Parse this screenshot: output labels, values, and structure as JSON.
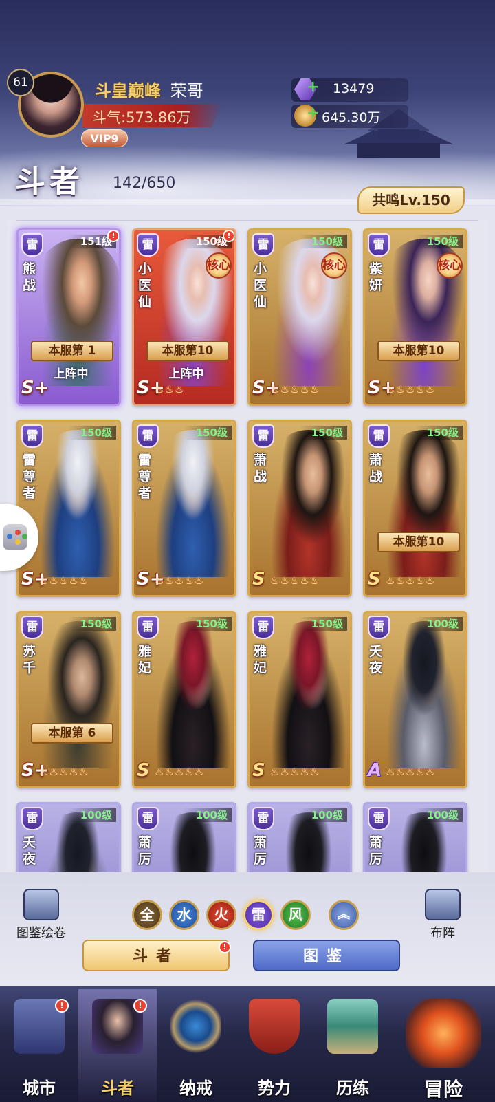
{
  "player": {
    "level": "61",
    "title": "斗皇巅峰",
    "name": "荣哥",
    "power_label": "斗气:573.86万",
    "vip": "VIP9"
  },
  "resources": {
    "crystal": "13479",
    "gold": "645.30万"
  },
  "section": {
    "title": "斗者",
    "count": "142/650",
    "resonance": "共鸣Lv.150"
  },
  "heroes": [
    {
      "name": "熊战",
      "level": "151级",
      "grade": "S+",
      "core": "",
      "rank": "本服第 1",
      "deployed": "上阵中",
      "stars": "",
      "alert": true,
      "frame": "purple",
      "element": "雷"
    },
    {
      "name": "小医仙",
      "level": "150级",
      "grade": "S+",
      "core": "核心",
      "rank": "本服第10",
      "deployed": "上阵中",
      "stars": "♨♨♨",
      "alert": true,
      "frame": "red",
      "element": "雷"
    },
    {
      "name": "小医仙",
      "level": "150级",
      "grade": "S+",
      "core": "核心",
      "rank": "",
      "deployed": "",
      "stars": "♨♨♨♨♨",
      "alert": false,
      "frame": "gold",
      "element": "雷"
    },
    {
      "name": "紫妍",
      "level": "150级",
      "grade": "S+",
      "core": "核心",
      "rank": "本服第10",
      "deployed": "",
      "stars": "♨♨♨♨♨",
      "alert": false,
      "frame": "gold",
      "element": "雷"
    },
    {
      "name": "雷尊者",
      "level": "150级",
      "grade": "S+",
      "core": "",
      "rank": "",
      "deployed": "",
      "stars": "♨♨♨♨♨",
      "alert": false,
      "frame": "gold",
      "element": "雷"
    },
    {
      "name": "雷尊者",
      "level": "150级",
      "grade": "S+",
      "core": "",
      "rank": "",
      "deployed": "",
      "stars": "♨♨♨♨♨",
      "alert": false,
      "frame": "gold",
      "element": "雷"
    },
    {
      "name": "萧战",
      "level": "150级",
      "grade": "S",
      "core": "",
      "rank": "",
      "deployed": "",
      "stars": "♨♨♨♨♨",
      "alert": false,
      "frame": "gold",
      "element": "雷"
    },
    {
      "name": "萧战",
      "level": "150级",
      "grade": "S",
      "core": "",
      "rank": "本服第10",
      "deployed": "",
      "stars": "♨♨♨♨♨",
      "alert": false,
      "frame": "gold",
      "element": "雷"
    },
    {
      "name": "苏千",
      "level": "150级",
      "grade": "S+",
      "core": "",
      "rank": "本服第 6",
      "deployed": "",
      "stars": "♨♨♨♨♨",
      "alert": false,
      "frame": "gold",
      "element": "雷"
    },
    {
      "name": "雅妃",
      "level": "150级",
      "grade": "S",
      "core": "",
      "rank": "",
      "deployed": "",
      "stars": "♨♨♨♨♨",
      "alert": false,
      "frame": "gold",
      "element": "雷"
    },
    {
      "name": "雅妃",
      "level": "150级",
      "grade": "S",
      "core": "",
      "rank": "",
      "deployed": "",
      "stars": "♨♨♨♨♨",
      "alert": false,
      "frame": "gold",
      "element": "雷"
    },
    {
      "name": "夭夜",
      "level": "100级",
      "grade": "A",
      "core": "",
      "rank": "",
      "deployed": "",
      "stars": "♨♨♨♨♨",
      "alert": false,
      "frame": "gold",
      "element": "雷"
    },
    {
      "name": "夭夜",
      "level": "100级",
      "grade": "",
      "core": "",
      "rank": "",
      "deployed": "",
      "stars": "",
      "alert": false,
      "frame": "purple-lite",
      "element": "雷"
    },
    {
      "name": "萧厉",
      "level": "100级",
      "grade": "",
      "core": "",
      "rank": "",
      "deployed": "",
      "stars": "",
      "alert": false,
      "frame": "purple-lite",
      "element": "雷"
    },
    {
      "name": "萧厉",
      "level": "100级",
      "grade": "",
      "core": "",
      "rank": "",
      "deployed": "",
      "stars": "",
      "alert": false,
      "frame": "purple-lite",
      "element": "雷"
    },
    {
      "name": "萧厉",
      "level": "100级",
      "grade": "",
      "core": "",
      "rank": "",
      "deployed": "",
      "stars": "",
      "alert": false,
      "frame": "purple-lite",
      "element": "雷"
    }
  ],
  "filters": [
    "全",
    "水",
    "火",
    "雷",
    "风"
  ],
  "side_buttons": {
    "gallery": "图鉴绘卷",
    "formation": "布阵"
  },
  "tabs": {
    "heroes": "斗者",
    "codex": "图鉴"
  },
  "nav": [
    "城市",
    "斗者",
    "纳戒",
    "势力",
    "历练",
    "冒险"
  ],
  "icons": {
    "crystal": "purple-crystal-icon",
    "gold": "gold-coin-icon",
    "collapse": "double-chevron-up-icon",
    "gamepad": "gamepad-icon"
  },
  "colors": {
    "gold_frame": "#d9a84a",
    "purple_frame": "#b692e8",
    "red_frame": "#e9a272",
    "alert": "#e8412f"
  }
}
